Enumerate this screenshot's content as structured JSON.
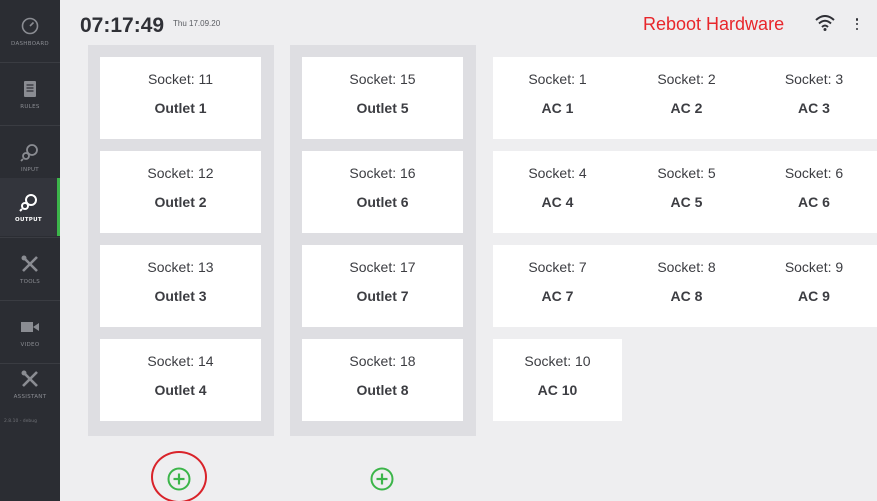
{
  "sidebar": {
    "items": [
      {
        "label": "DASHBOARD",
        "icon": "dashboard-gauge-icon"
      },
      {
        "label": "RULES",
        "icon": "rules-document-icon"
      },
      {
        "label": "INPUT",
        "icon": "input-plug-icon"
      },
      {
        "label": "OUTPUT",
        "icon": "output-plug-icon",
        "active": true
      },
      {
        "label": "TOOLS",
        "icon": "tools-icon"
      },
      {
        "label": "VIDEO",
        "icon": "video-camera-icon"
      },
      {
        "label": "ASSISTANT",
        "icon": "assistant-tools-icon"
      }
    ],
    "version": "2.8.10 - debug"
  },
  "header": {
    "time": "07:17:49",
    "date": "Thu 17.09.20",
    "reboot_label": "Reboot Hardware"
  },
  "colors": {
    "accent_green": "#3cb54a",
    "reboot_red": "#e8262b",
    "sidebar_bg": "#2b2d33"
  },
  "outlet_columns": [
    [
      {
        "socket": "Socket: 11",
        "outlet": "Outlet 1"
      },
      {
        "socket": "Socket: 12",
        "outlet": "Outlet 2"
      },
      {
        "socket": "Socket: 13",
        "outlet": "Outlet 3"
      },
      {
        "socket": "Socket: 14",
        "outlet": "Outlet 4"
      }
    ],
    [
      {
        "socket": "Socket: 15",
        "outlet": "Outlet 5"
      },
      {
        "socket": "Socket: 16",
        "outlet": "Outlet 6"
      },
      {
        "socket": "Socket: 17",
        "outlet": "Outlet 7"
      },
      {
        "socket": "Socket: 18",
        "outlet": "Outlet 8"
      }
    ]
  ],
  "ac_sockets": [
    {
      "socket": "Socket: 1",
      "outlet": "AC 1"
    },
    {
      "socket": "Socket: 2",
      "outlet": "AC 2"
    },
    {
      "socket": "Socket: 3",
      "outlet": "AC 3"
    },
    {
      "socket": "Socket: 4",
      "outlet": "AC 4"
    },
    {
      "socket": "Socket: 5",
      "outlet": "AC 5"
    },
    {
      "socket": "Socket: 6",
      "outlet": "AC 6"
    },
    {
      "socket": "Socket: 7",
      "outlet": "AC 7"
    },
    {
      "socket": "Socket: 8",
      "outlet": "AC 8"
    },
    {
      "socket": "Socket: 9",
      "outlet": "AC 9"
    },
    {
      "socket": "Socket: 10",
      "outlet": "AC 10"
    }
  ]
}
